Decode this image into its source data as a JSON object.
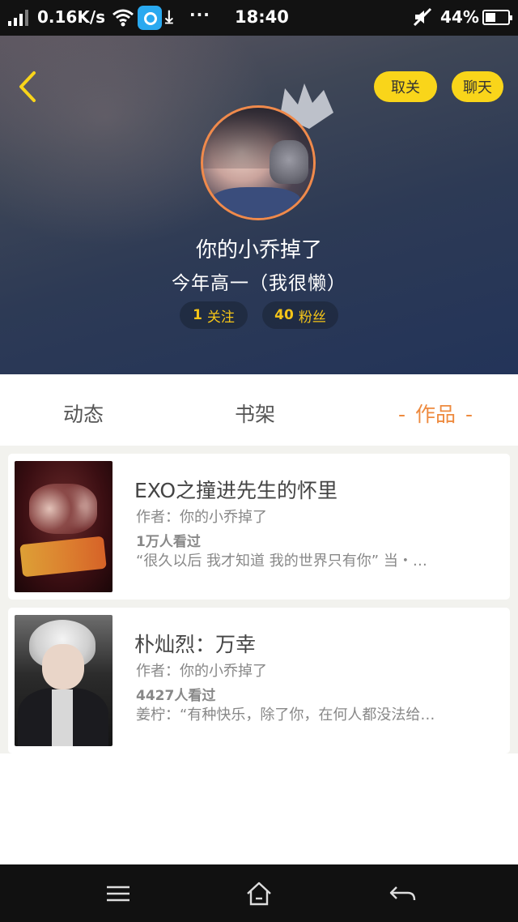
{
  "status_bar": {
    "speed": "0.16K/s",
    "time": "18:40",
    "battery": "44%",
    "icons": [
      "signal-icon",
      "wifi-icon",
      "app-notification-icon",
      "download-icon",
      "more-icon",
      "mute-icon",
      "battery-icon"
    ]
  },
  "header": {
    "back_icon": "chevron-left-icon",
    "unfollow_label": "取关",
    "chat_label": "聊天",
    "nickname": "你的小乔掉了",
    "bio": "今年高一（我很懒）",
    "following_count": "1",
    "following_label": "关注",
    "followers_count": "40",
    "followers_label": "粉丝",
    "accent": "#f9d51a",
    "avatar_ring": "#f08a4b"
  },
  "tabs": [
    {
      "label": "动态",
      "active": false
    },
    {
      "label": "书架",
      "active": false
    },
    {
      "label": "作品",
      "active": true,
      "dash": "-"
    }
  ],
  "active_tab_color": "#ee8a3e",
  "works": [
    {
      "title": "EXO之撞进先生的怀里",
      "author": "作者：你的小乔掉了",
      "views": "1万人看过",
      "intro": "“很久以后 我才知道 我的世界只有你” 当・…"
    },
    {
      "title": "朴灿烈：万幸",
      "author": "作者：你的小乔掉了",
      "views": "4427人看过",
      "intro": "姜柠：“有种快乐，除了你，在何人都没法给…"
    }
  ],
  "nav_bar": {
    "icons": [
      "menu-icon",
      "home-icon",
      "back-icon"
    ]
  }
}
